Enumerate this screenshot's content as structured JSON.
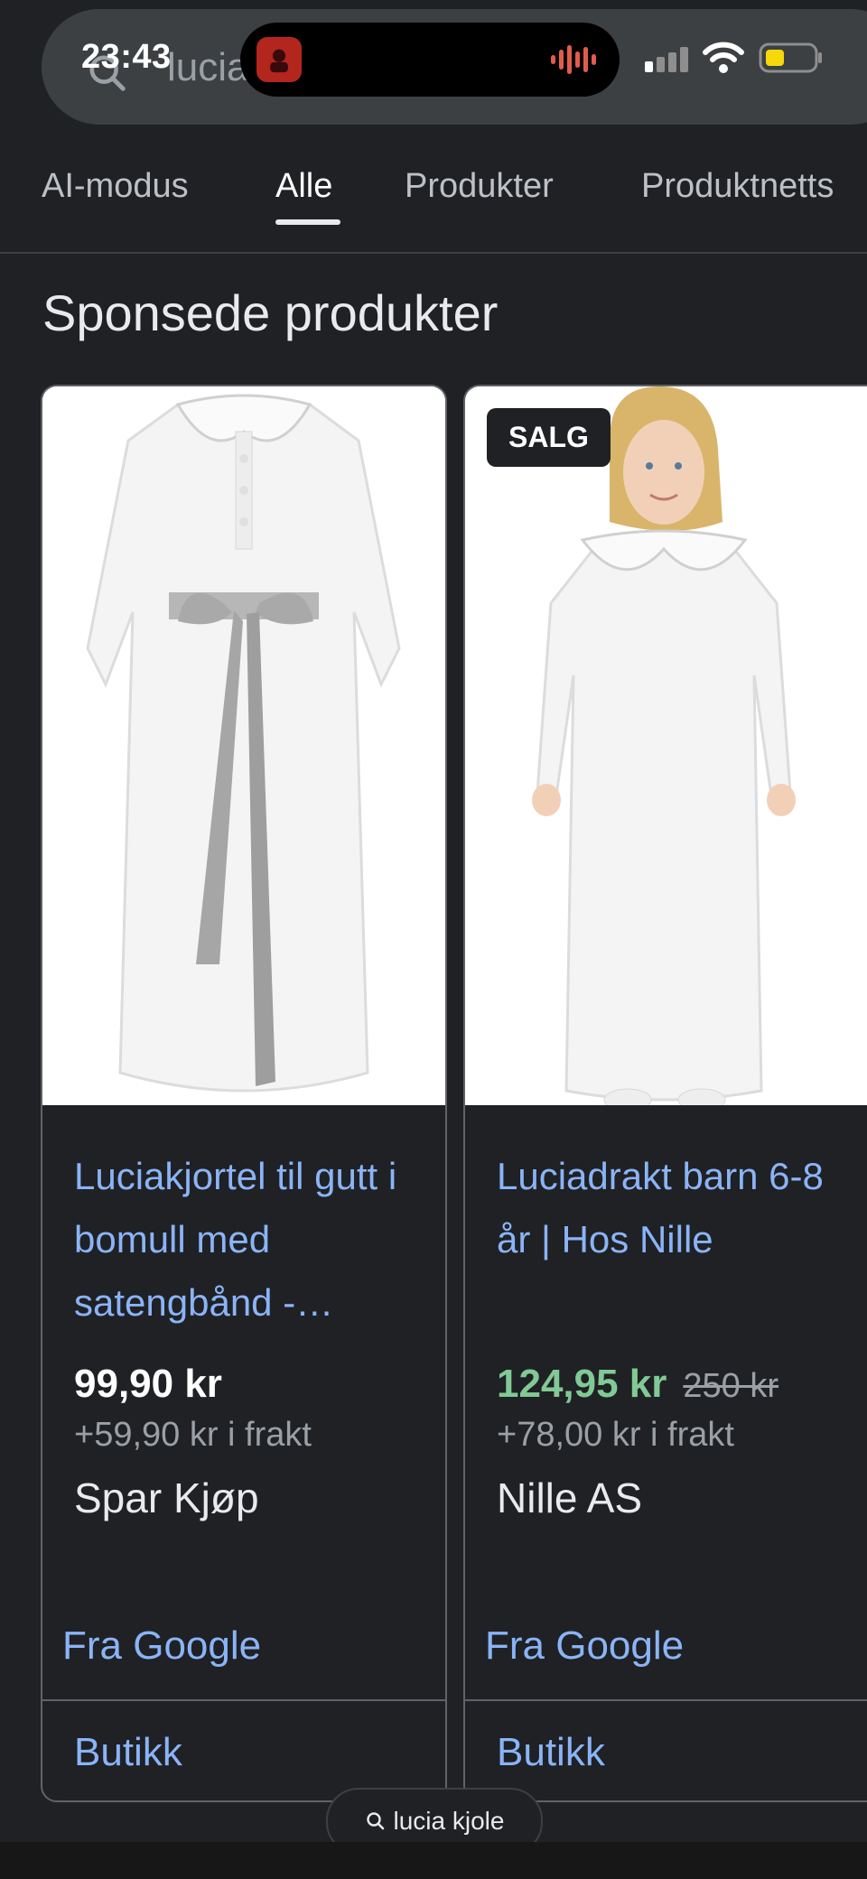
{
  "status_bar": {
    "time": "23:43"
  },
  "search": {
    "query": "lucia"
  },
  "tabs": [
    {
      "label": "AI-modus"
    },
    {
      "label": "Alle"
    },
    {
      "label": "Produkter"
    },
    {
      "label": "Produktnetts"
    }
  ],
  "section": {
    "title": "Sponsede produkter"
  },
  "products": [
    {
      "title": "Luciakjortel til gutt i bomull med satengbånd -…",
      "price": "99,90 kr",
      "shipping": "+59,90 kr i frakt",
      "merchant": "Spar Kjøp",
      "source": "Fra Google",
      "shop": "Butikk"
    },
    {
      "badge": "SALG",
      "title": "Luciadrakt barn 6-8 år | Hos Nille",
      "price": "124,95 kr",
      "old_price": "250 kr",
      "shipping": "+78,00 kr i frakt",
      "merchant": "Nille AS",
      "source": "Fra Google",
      "shop": "Butikk"
    }
  ],
  "floating_search": {
    "label": "lucia kjole"
  },
  "colors": {
    "link": "#8ab4f8",
    "sale_price": "#81c995",
    "background": "#202124"
  }
}
